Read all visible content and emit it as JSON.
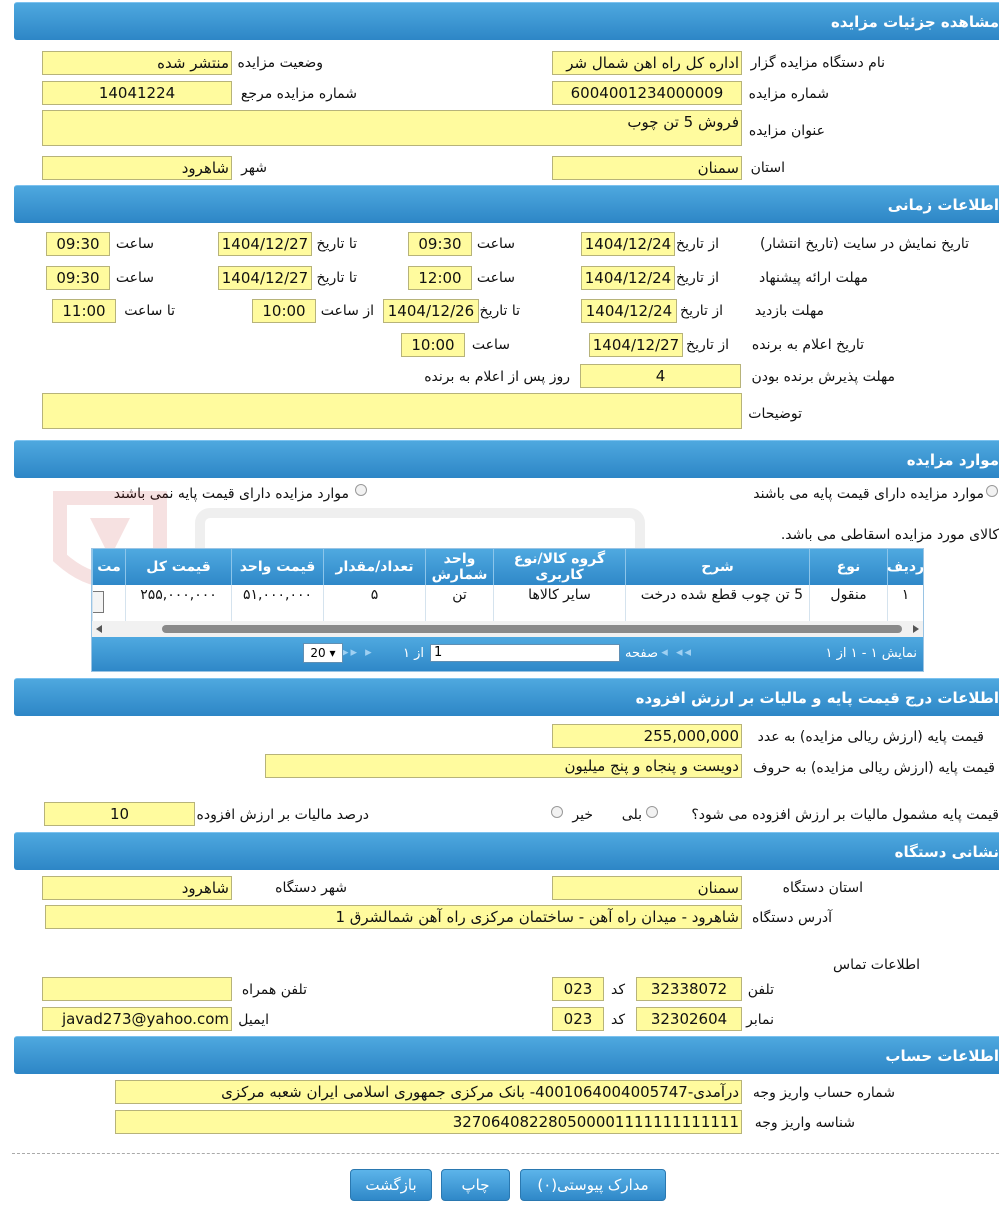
{
  "sections": {
    "details": "مشاهده جزئیات مزایده",
    "time": "اطلاعات زمانی",
    "items": "موارد مزایده",
    "price": "اطلاعات درج قیمت پایه و مالیات بر ارزش افزوده",
    "address": "نشانی دستگاه",
    "account": "اطلاعات حساب"
  },
  "details": {
    "org_label": "نام دستگاه مزایده گزار",
    "org_value": "اداره کل راه اهن شمال شر",
    "status_label": "وضعیت مزایده",
    "status_value": "منتشر شده",
    "number_label": "شماره مزایده",
    "number_value": "6004001234000009",
    "ref_label": "شماره مزایده مرجع",
    "ref_value": "14041224",
    "title_label": "عنوان مزایده",
    "title_value": "فروش 5 تن چوب",
    "province_label": "استان",
    "province_value": "سمنان",
    "city_label": "شهر",
    "city_value": "شاهرود"
  },
  "time": {
    "from_date": "از تاریخ",
    "to_date": "تا تاریخ",
    "hour": "ساعت",
    "from_hour": "از ساعت",
    "to_hour": "تا ساعت",
    "display_label": "تاریخ نمایش در سایت (تاریخ انتشار)",
    "display_from": "1404/12/24",
    "display_from_time": "09:30",
    "display_to": "1404/12/27",
    "display_to_time": "09:30",
    "offer_label": "مهلت ارائه پیشنهاد",
    "offer_from": "1404/12/24",
    "offer_from_time": "12:00",
    "offer_to": "1404/12/27",
    "offer_to_time": "09:30",
    "visit_label": "مهلت بازدید",
    "visit_from": "1404/12/24",
    "visit_to": "1404/12/26",
    "visit_from_time": "10:00",
    "visit_to_time": "11:00",
    "winner_label": "تاریخ اعلام به برنده",
    "winner_from": "1404/12/27",
    "winner_time": "10:00",
    "accept_label": "مهلت پذیرش برنده بودن",
    "accept_value": "4",
    "accept_suffix": "روز پس از اعلام به برنده",
    "desc_label": "توضیحات",
    "desc_value": ""
  },
  "items": {
    "radio_with": "موارد مزایده دارای قیمت پایه می باشند",
    "radio_without": "موارد مزایده دارای قیمت پایه نمی باشند",
    "note": "کالای مورد مزایده اسقاطی می باشد.",
    "columns": [
      "ردیف",
      "نوع",
      "شرح",
      "گروه کالا/نوع کاربری",
      "واحد شمارش",
      "تعداد/مقدار",
      "قیمت واحد",
      "قیمت کل",
      "مت"
    ],
    "row": [
      "۱",
      "منقول",
      "5 تن چوب قطع شده درخت",
      "سایر کالاها",
      "تن",
      "۵",
      "۵۱,۰۰۰,۰۰۰",
      "۲۵۵,۰۰۰,۰۰۰",
      ""
    ],
    "pager_display": "نمایش ۱ - ۱ از ۱",
    "pager_page": "صفحه",
    "pager_page_value": "1",
    "pager_of": "از ۱",
    "pager_size": "20"
  },
  "price": {
    "number_label": "قیمت پایه (ارزش ریالی مزایده) به عدد",
    "number_value": "255,000,000",
    "words_label": "قیمت پایه (ارزش ریالی مزایده) به حروف",
    "words_value": "دویست و پنجاه و پنج میلیون",
    "vat_question": "قیمت پایه مشمول مالیات بر ارزش افزوده می شود؟",
    "yes": "بلی",
    "no": "خیر",
    "vat_percent_label": "درصد مالیات بر ارزش افزوده",
    "vat_percent_value": "10"
  },
  "address": {
    "province_label": "استان دستگاه",
    "province_value": "سمنان",
    "city_label": "شهر دستگاه",
    "city_value": "شاهرود",
    "addr_label": "آدرس دستگاه",
    "addr_value": "شاهرود - میدان راه آهن - ساختمان مرکزی راه آهن شمالشرق 1",
    "contact_label": "اطلاعات تماس",
    "phone_label": "تلفن",
    "phone_value": "32338072",
    "code_label": "کد",
    "phone_code": "023",
    "mobile_label": "تلفن همراه",
    "mobile_value": "",
    "fax_label": "نمابر",
    "fax_value": "32302604",
    "fax_code": "023",
    "email_label": "ایمیل",
    "email_value": "javad273@yahoo.com"
  },
  "account": {
    "account_label": "شماره حساب واریز وجه",
    "account_value": "درآمدی-4001064004005747- بانک مرکزی جمهوری اسلامی ایران شعبه مرکزی",
    "id_label": "شناسه واریز وجه",
    "id_value": "327064082280500001111111111111"
  },
  "buttons": {
    "attachments": "مدارک پیوستی(۰)",
    "print": "چاپ",
    "back": "بازگشت"
  },
  "colors": {
    "header": "#2d86c6",
    "field": "#fffb9e"
  }
}
